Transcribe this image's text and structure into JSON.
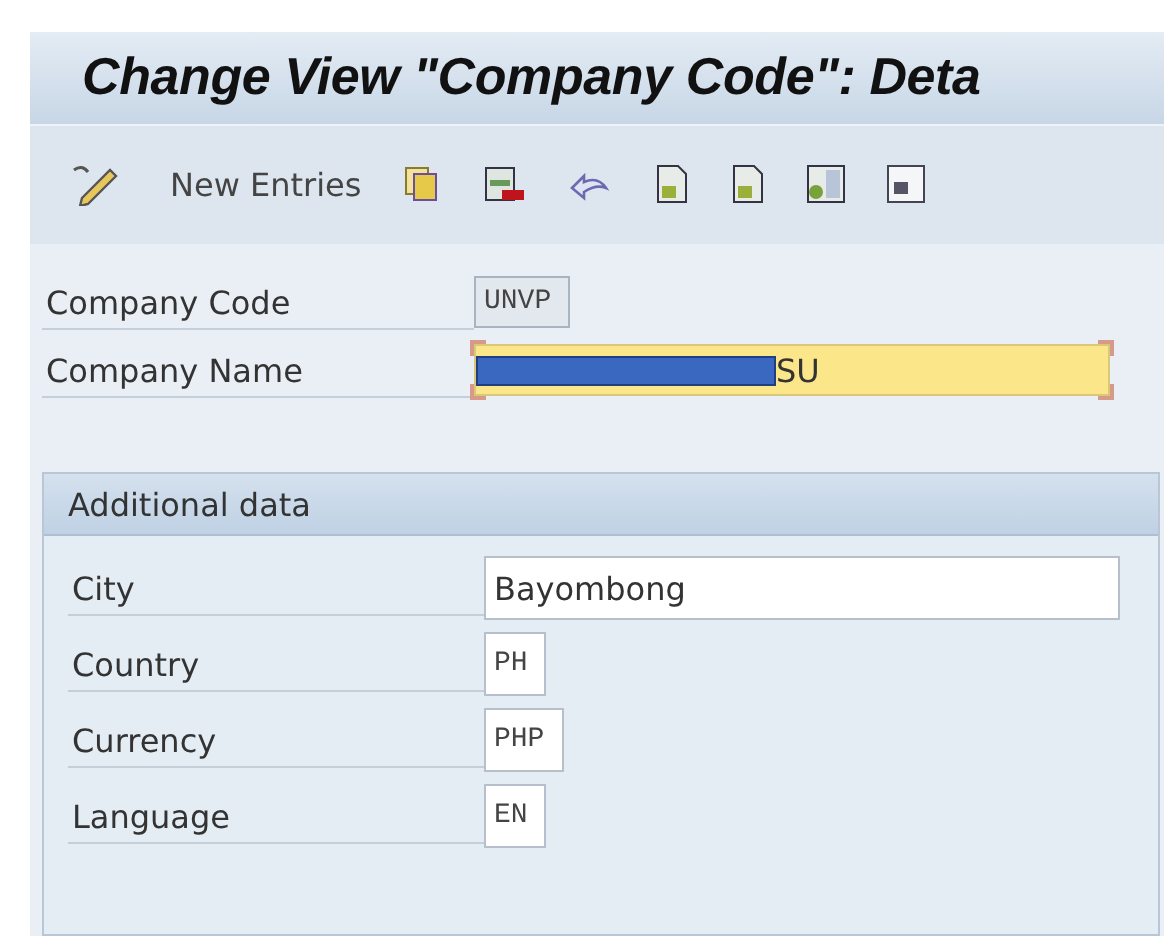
{
  "window": {
    "title": "Change View \"Company Code\": Deta"
  },
  "toolbar": {
    "items": [
      {
        "kind": "icon"
      },
      {
        "kind": "text",
        "label": "New Entries"
      },
      {
        "kind": "icon"
      },
      {
        "kind": "icon"
      },
      {
        "kind": "icon"
      },
      {
        "kind": "icon"
      },
      {
        "kind": "icon"
      },
      {
        "kind": "icon"
      },
      {
        "kind": "icon"
      }
    ]
  },
  "header_fields": [
    {
      "kind": "code",
      "label": "Company Code",
      "value": "UNVP",
      "disabled": true,
      "focused": false
    },
    {
      "kind": "text",
      "label": "Company Name",
      "value": "SU",
      "disabled": false,
      "focused": true
    }
  ],
  "group": {
    "title": "Additional data",
    "fields": [
      {
        "kind": "text",
        "label": "City",
        "value": "Bayombong",
        "disabled": false,
        "focused": false
      },
      {
        "kind": "code",
        "label": "Country",
        "value": "PH",
        "disabled": false,
        "focused": false
      },
      {
        "kind": "code",
        "label": "Currency",
        "value": "PHP",
        "disabled": false,
        "focused": false
      },
      {
        "kind": "code",
        "label": "Language",
        "value": "EN",
        "disabled": false,
        "focused": false
      }
    ]
  }
}
